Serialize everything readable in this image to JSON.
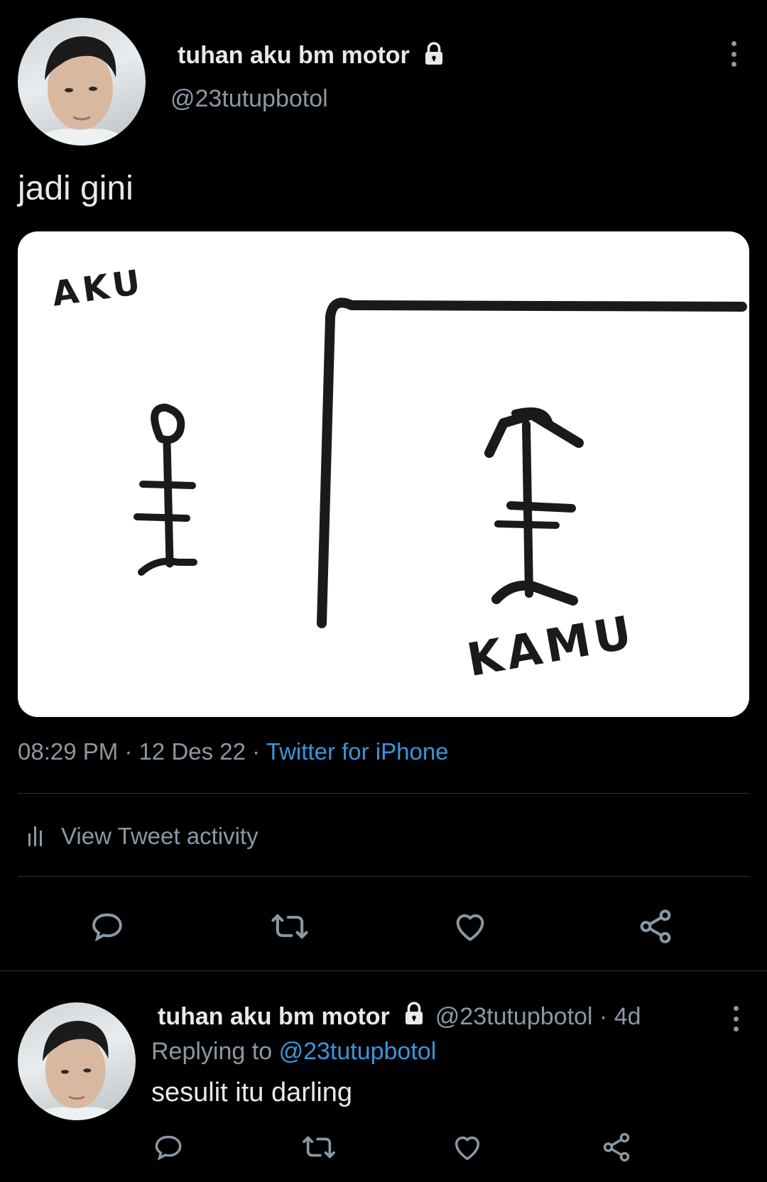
{
  "tweet": {
    "display_name": "tuhan aku bm motor",
    "handle": "@23tutupbotol",
    "text": "jadi gini",
    "drawing": {
      "label_left": "AKU",
      "label_right": "KAMU"
    },
    "time": "08:29 PM",
    "date": "12 Des 22",
    "source": "Twitter for iPhone",
    "activity_label": "View Tweet activity"
  },
  "reply": {
    "display_name": "tuhan aku bm motor",
    "handle": "@23tutupbotol",
    "age": "4d",
    "replying_to_prefix": "Replying to",
    "replying_to_handle": "@23tutupbotol",
    "text": "sesulit itu darling"
  },
  "colors": {
    "background": "#000000",
    "text": "#e7e9ea",
    "muted": "#8b98a5",
    "link": "#3b94d9",
    "divider": "#2f3336"
  },
  "icons": [
    "lock-icon",
    "more-icon",
    "bar-chart-icon",
    "reply-icon",
    "retweet-icon",
    "like-icon",
    "share-icon"
  ]
}
